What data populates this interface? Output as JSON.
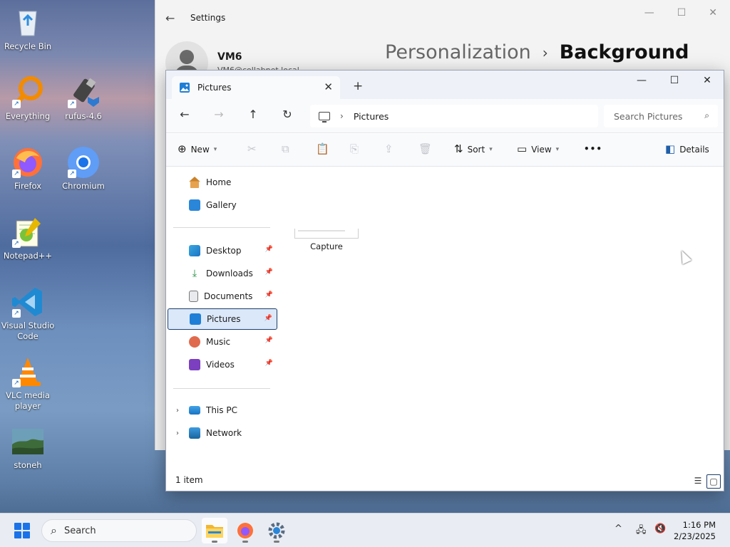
{
  "desktop": {
    "icons": [
      {
        "label": "Recycle Bin",
        "icon": "recycle-bin-icon"
      },
      {
        "label": "Everything",
        "icon": "everything-icon"
      },
      {
        "label": "rufus-4.6",
        "icon": "rufus-icon"
      },
      {
        "label": "Firefox",
        "icon": "firefox-icon"
      },
      {
        "label": "Chromium",
        "icon": "chromium-icon"
      },
      {
        "label": "Notepad++",
        "icon": "notepad-plus-plus-icon"
      },
      {
        "label": "Visual Studio Code",
        "icon": "vscode-icon"
      },
      {
        "label": "VLC media player",
        "icon": "vlc-icon"
      },
      {
        "label": "stoneh",
        "icon": "image-file-icon"
      }
    ]
  },
  "settings": {
    "app_title": "Settings",
    "user_name": "VM6",
    "user_email": "VM6@collabnet.local",
    "breadcrumb_parent": "Personalization",
    "breadcrumb_current": "Background"
  },
  "explorer": {
    "tab_title": "Pictures",
    "address": "Pictures",
    "search_placeholder": "Search Pictures",
    "toolbar": {
      "new_label": "New",
      "sort_label": "Sort",
      "view_label": "View",
      "more_label": "•••",
      "details_label": "Details"
    },
    "sidebar": {
      "quick": [
        {
          "label": "Home"
        },
        {
          "label": "Gallery"
        }
      ],
      "pinned": [
        {
          "label": "Desktop"
        },
        {
          "label": "Downloads"
        },
        {
          "label": "Documents"
        },
        {
          "label": "Pictures",
          "selected": true
        },
        {
          "label": "Music"
        },
        {
          "label": "Videos"
        }
      ],
      "locations": [
        {
          "label": "This PC"
        },
        {
          "label": "Network"
        }
      ]
    },
    "files": [
      {
        "name": "Capture"
      }
    ],
    "status": "1 item"
  },
  "taskbar": {
    "search_placeholder": "Search",
    "time": "1:16 PM",
    "date": "2/23/2025"
  },
  "colors": {
    "accent": "#1a73e8",
    "selection_bg": "#dbe8f9",
    "selection_border": "#1c3d6b"
  }
}
